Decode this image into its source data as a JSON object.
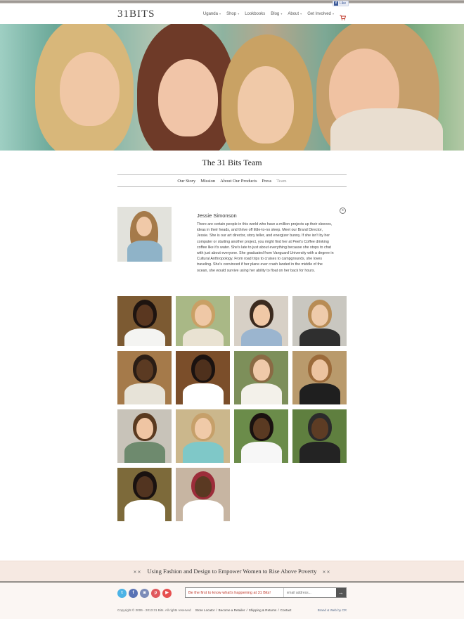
{
  "facebook": {
    "like_label": "Like"
  },
  "header": {
    "logo": "31BITS",
    "nav": [
      {
        "label": "Uganda",
        "caret": true
      },
      {
        "label": "Shop",
        "caret": true
      },
      {
        "label": "Lookbooks",
        "caret": false
      },
      {
        "label": "Blog",
        "caret": true
      },
      {
        "label": "About",
        "caret": true
      },
      {
        "label": "Get Involved",
        "caret": true
      }
    ],
    "cart_icon": "cart-icon"
  },
  "page": {
    "title": "The 31 Bits Team",
    "subnav": [
      "Our Story",
      "Mission",
      "About Our Products",
      "Press",
      "Team"
    ],
    "active_subnav": "Team"
  },
  "bio": {
    "name": "Jessie Simonson",
    "text": "There are certain people in this world who have a million projects up their sleeves, ideas in their heads, and thrive off little-to-no sleep. Meet our Brand Director, Jessie. She is our art director, story teller, and energizer bunny. If she isn't by her computer or starting another project, you might find her at Peet's Coffee drinking coffee like it's water. She's late to just about everything because she stops to chat with just about everyone. She graduated from Vanguard University with a degree in Cultural Anthropology. From road trips to cruises to campgrounds, she loves traveling. She's convinced if her plane ever crash landed in the middle of the ocean, she would survive using her ability to float on her back for hours.",
    "close_label": "x"
  },
  "footer": {
    "tagline": "Using Fashion and Design to Empower Women to Rise Above Poverty",
    "tagline_deco": "✕✕",
    "social": [
      {
        "name": "twitter-icon",
        "glyph": "t",
        "color": "#4cb3e6"
      },
      {
        "name": "facebook-icon",
        "glyph": "f",
        "color": "#5a73b5"
      },
      {
        "name": "instagram-icon",
        "glyph": "◙",
        "color": "#7c8cb8"
      },
      {
        "name": "pinterest-icon",
        "glyph": "p",
        "color": "#e0595e"
      },
      {
        "name": "youtube-icon",
        "glyph": "▶",
        "color": "#e65050"
      }
    ],
    "newsletter_label": "Be the first to know what's happening at 31 Bits!",
    "newsletter_placeholder": "email address...",
    "newsletter_submit": "→",
    "copyright": "Copyright © 2006 - 2013 31 Bits. All rights reserved",
    "links": [
      "Store Locator",
      "Become a Retailer",
      "Shipping & Returns",
      "Contact"
    ],
    "credit": "Brand & Web by CR"
  }
}
